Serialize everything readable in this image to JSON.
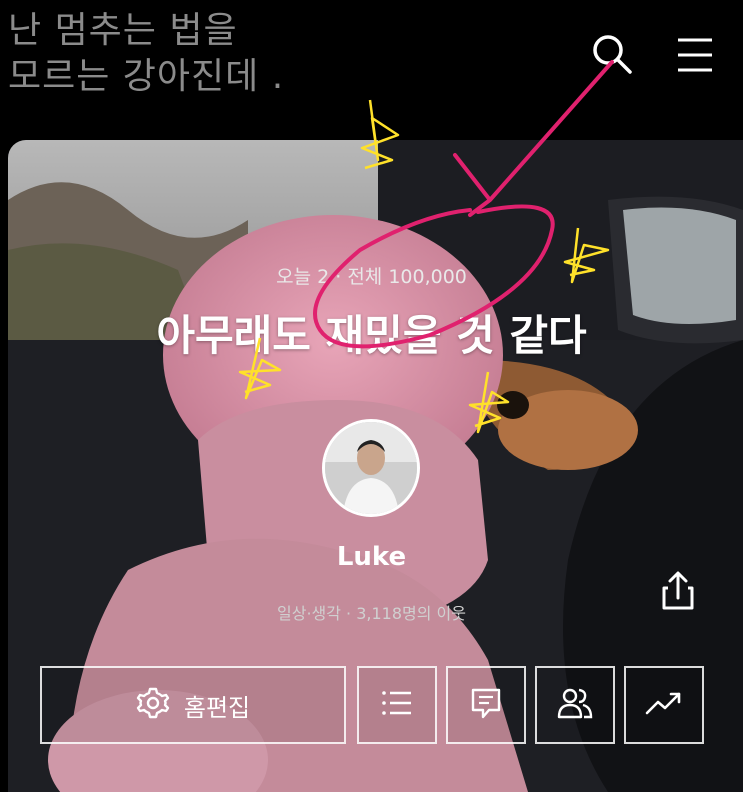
{
  "blog": {
    "title_line1": "난 멈추는 법을",
    "title_line2": "모르는 강아진데 ."
  },
  "header": {
    "search_icon": "search-icon",
    "menu_icon": "hamburger-menu-icon"
  },
  "cover": {
    "visits": "오늘 2 · 전체 100,000",
    "post_title": "아무래도 재밌을 것 같다",
    "nickname": "Luke",
    "subinfo": "일상·생각 · 3,118명의 이웃"
  },
  "actions": {
    "home_edit_label": "홈편집",
    "icons": [
      "gear-icon",
      "list-icon",
      "comment-icon",
      "neighbors-icon",
      "stats-icon",
      "share-icon"
    ]
  },
  "colors": {
    "annotation_pink": "#e0216e",
    "annotation_yellow": "#ffe12a",
    "title_gray": "#8b8b8b"
  }
}
